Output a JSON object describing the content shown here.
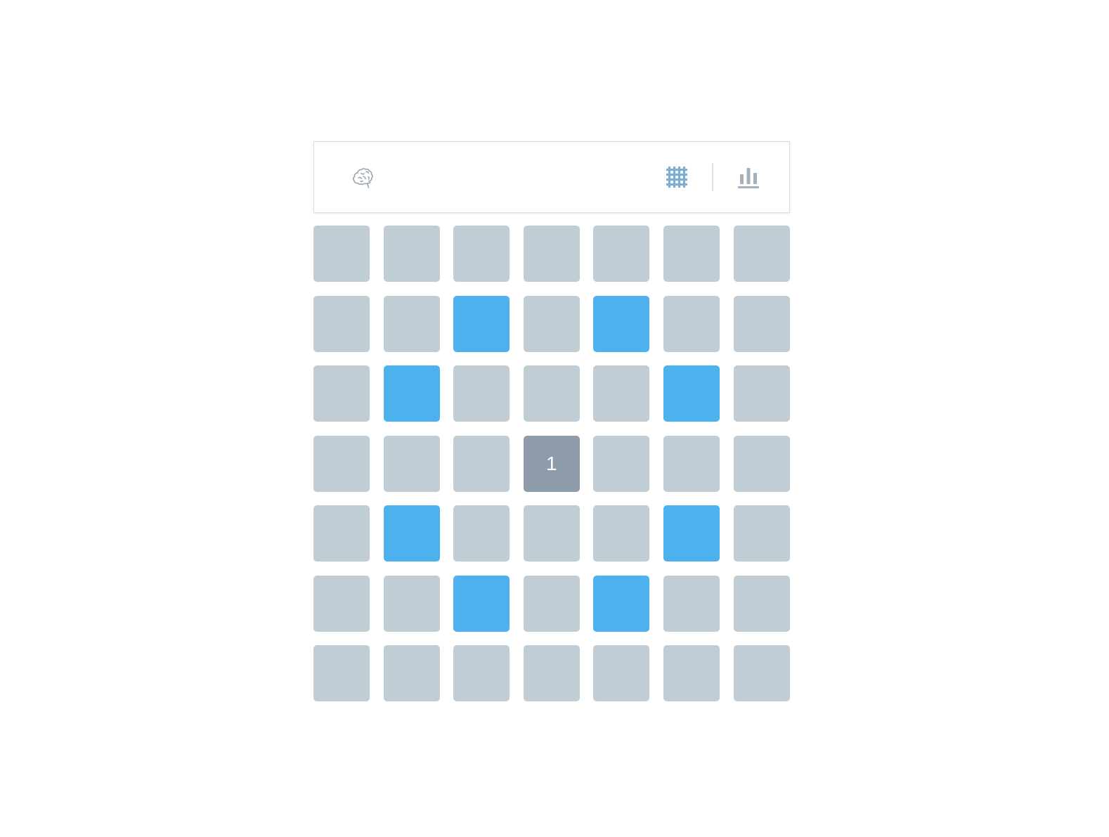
{
  "header": {
    "brain_icon": "brain-icon",
    "grid_icon": "grid-icon",
    "stats_icon": "bar-chart-icon"
  },
  "colors": {
    "tile_default": "#c1cdd5",
    "tile_highlight": "#4db1ee",
    "tile_active": "#8d9ca8",
    "icon_grid": "#7eaed1",
    "icon_stats": "#a4b0bb",
    "icon_brain": "#9aa6b0"
  },
  "board": {
    "rows": 7,
    "cols": 7,
    "cells": [
      [
        "empty",
        "empty",
        "empty",
        "empty",
        "empty",
        "empty",
        "empty"
      ],
      [
        "empty",
        "empty",
        "blue",
        "empty",
        "blue",
        "empty",
        "empty"
      ],
      [
        "empty",
        "blue",
        "empty",
        "empty",
        "empty",
        "blue",
        "empty"
      ],
      [
        "empty",
        "empty",
        "empty",
        "active",
        "empty",
        "empty",
        "empty"
      ],
      [
        "empty",
        "blue",
        "empty",
        "empty",
        "empty",
        "blue",
        "empty"
      ],
      [
        "empty",
        "empty",
        "blue",
        "empty",
        "blue",
        "empty",
        "empty"
      ],
      [
        "empty",
        "empty",
        "empty",
        "empty",
        "empty",
        "empty",
        "empty"
      ]
    ],
    "active_label": "1"
  }
}
